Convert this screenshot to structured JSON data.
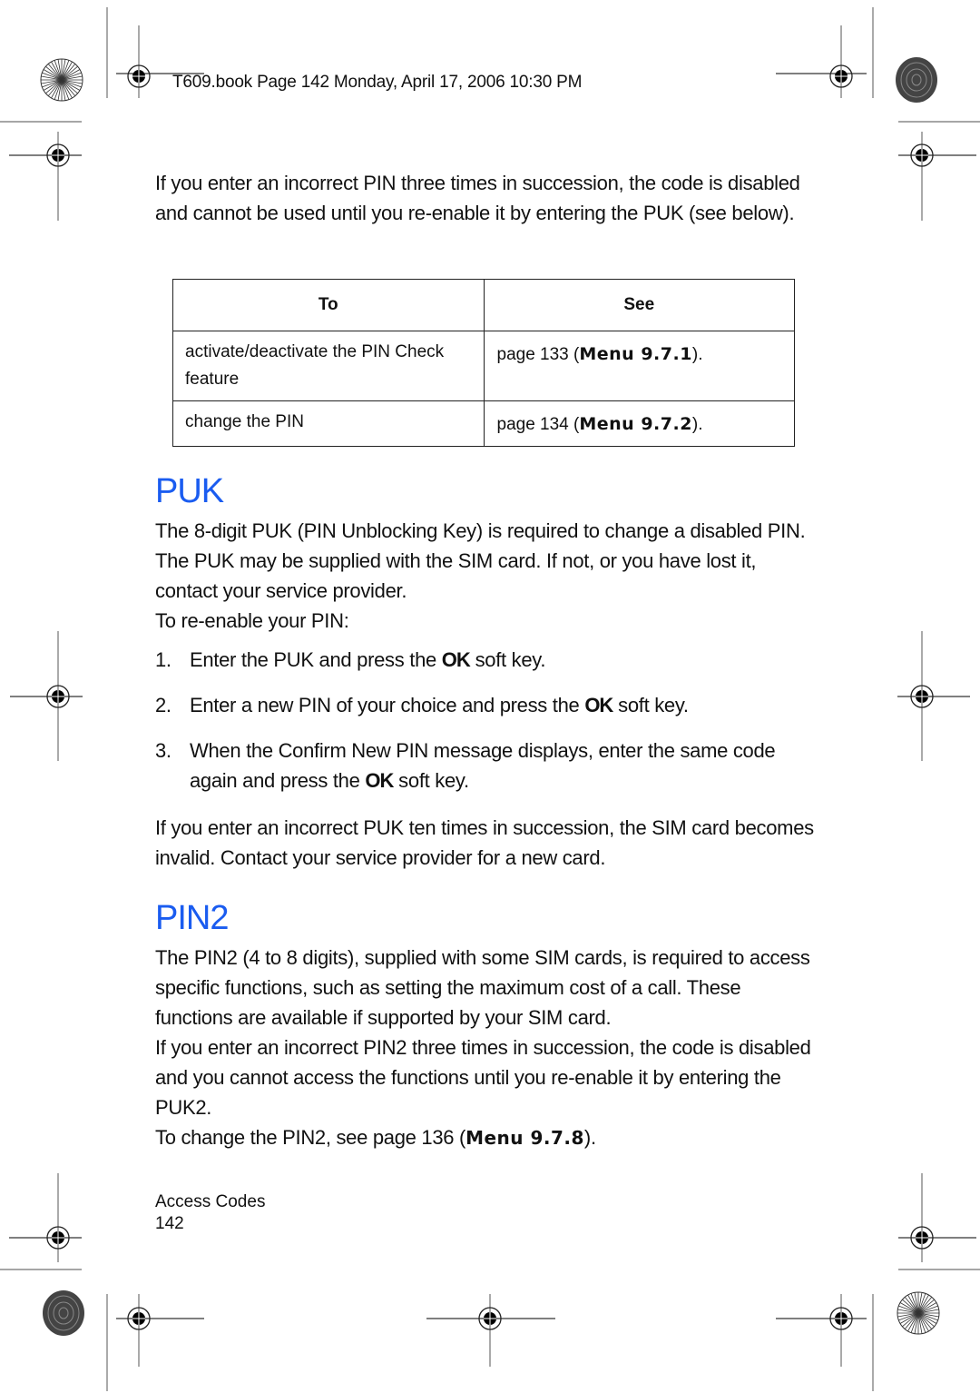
{
  "print_header": "T609.book  Page 142  Monday, April 17, 2006  10:30 PM",
  "intro_paragraph": "If you enter an incorrect PIN three times in succession, the code is disabled and cannot be used until you re-enable it by entering the PUK (see below).",
  "reference_table": {
    "headers": [
      "To",
      "See"
    ],
    "rows": [
      {
        "to": "activate/deactivate the PIN Check feature",
        "see_prefix": "page 133 (",
        "menu": "Menu 9.7.1",
        "see_suffix": ")."
      },
      {
        "to": "change the PIN",
        "see_prefix": "page 134 (",
        "menu": "Menu 9.7.2",
        "see_suffix": ")."
      }
    ]
  },
  "puk_section": {
    "heading": "PUK",
    "paragraph": "The 8-digit PUK (PIN Unblocking Key) is required to change a disabled PIN. The PUK may be supplied with the SIM card. If not, or you have lost it, contact your service provider.",
    "lead_in": "To re-enable your PIN:",
    "steps": [
      {
        "num": "1.",
        "before": "Enter the PUK and press the ",
        "key": "OK",
        "after": " soft key."
      },
      {
        "num": "2.",
        "before": "Enter a new PIN of your choice and press the ",
        "key": "OK",
        "after": " soft key."
      },
      {
        "num": "3.",
        "before": "When the Confirm New PIN message displays, enter the same code again and press the ",
        "key": "OK",
        "after": " soft key."
      }
    ],
    "warning": "If you enter an incorrect PUK ten times in succession, the SIM card becomes invalid. Contact your service provider for a new card."
  },
  "pin2_section": {
    "heading": "PIN2",
    "paragraph1": "The PIN2 (4 to 8 digits), supplied with some SIM cards, is required to access specific functions, such as setting the maximum cost of a call. These functions are available if supported by your SIM card.",
    "paragraph2": "If you enter an incorrect PIN2 three times in succession, the code is disabled and you cannot access the functions until you re-enable it by entering the PUK2.",
    "change_prefix": "To change the PIN2, see page 136 (",
    "change_menu": "Menu 9.7.8",
    "change_suffix": ")."
  },
  "footer": {
    "section": "Access Codes",
    "page_number": "142"
  },
  "colors": {
    "heading": "#1a5cf0",
    "text": "#111111"
  }
}
